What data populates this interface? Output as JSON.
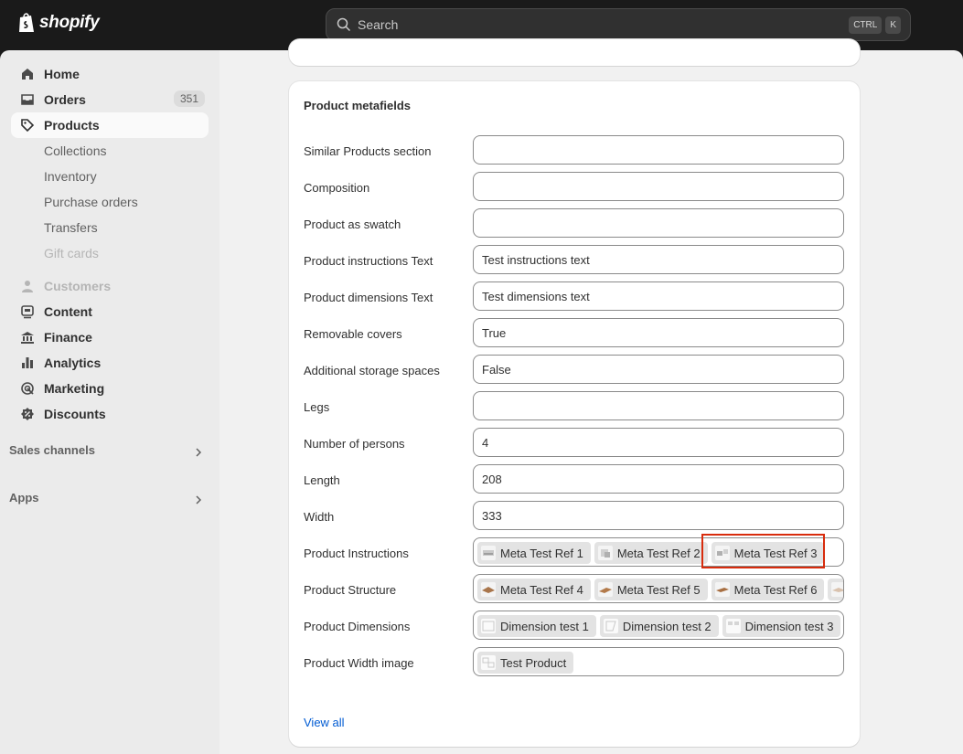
{
  "brand": {
    "name": "shopify"
  },
  "search": {
    "placeholder": "Search",
    "shortcut_keys": [
      "CTRL",
      "K"
    ]
  },
  "sidebar": {
    "items": [
      {
        "label": "Home",
        "icon": "home-icon"
      },
      {
        "label": "Orders",
        "icon": "inbox-icon",
        "badge": "351"
      },
      {
        "label": "Products",
        "icon": "tag-icon",
        "active": true
      }
    ],
    "product_subitems": [
      "Collections",
      "Inventory",
      "Purchase orders",
      "Transfers",
      "Gift cards"
    ],
    "items2": [
      {
        "label": "Customers",
        "icon": "person-icon",
        "disabled": true
      },
      {
        "label": "Content",
        "icon": "content-icon"
      },
      {
        "label": "Finance",
        "icon": "bank-icon"
      },
      {
        "label": "Analytics",
        "icon": "bar-chart-icon"
      },
      {
        "label": "Marketing",
        "icon": "target-icon"
      },
      {
        "label": "Discounts",
        "icon": "discount-icon"
      }
    ],
    "sections": [
      "Sales channels",
      "Apps"
    ]
  },
  "card": {
    "title": "Product metafields",
    "rows": [
      {
        "label": "Similar Products section",
        "value": ""
      },
      {
        "label": "Composition",
        "value": ""
      },
      {
        "label": "Product as swatch",
        "value": ""
      },
      {
        "label": "Product instructions Text",
        "value": "Test instructions text"
      },
      {
        "label": "Product dimensions Text",
        "value": "Test dimensions text"
      },
      {
        "label": "Removable covers",
        "value": "True"
      },
      {
        "label": "Additional storage spaces",
        "value": "False"
      },
      {
        "label": "Legs",
        "value": ""
      },
      {
        "label": "Number of persons",
        "value": "4"
      },
      {
        "label": "Length",
        "value": "208"
      },
      {
        "label": "Width",
        "value": "333"
      },
      {
        "label": "Product Instructions",
        "chips": [
          "Meta Test Ref 1",
          "Meta Test Ref 2",
          "Meta Test Ref 3"
        ]
      },
      {
        "label": "Product Structure",
        "chips": [
          "Meta Test Ref 4",
          "Meta Test Ref 5",
          "Meta Test Ref 6",
          ""
        ]
      },
      {
        "label": "Product Dimensions",
        "chips": [
          "Dimension test 1",
          "Dimension test 2",
          "Dimension test 3"
        ]
      },
      {
        "label": "Product Width image",
        "chips": [
          "Test Product"
        ]
      }
    ],
    "view_all": "View all"
  },
  "colors": {
    "accent": "#005bd3",
    "highlight": "#d82c0d",
    "topbar": "#1a1a1a",
    "sidebar": "#ebebeb"
  }
}
